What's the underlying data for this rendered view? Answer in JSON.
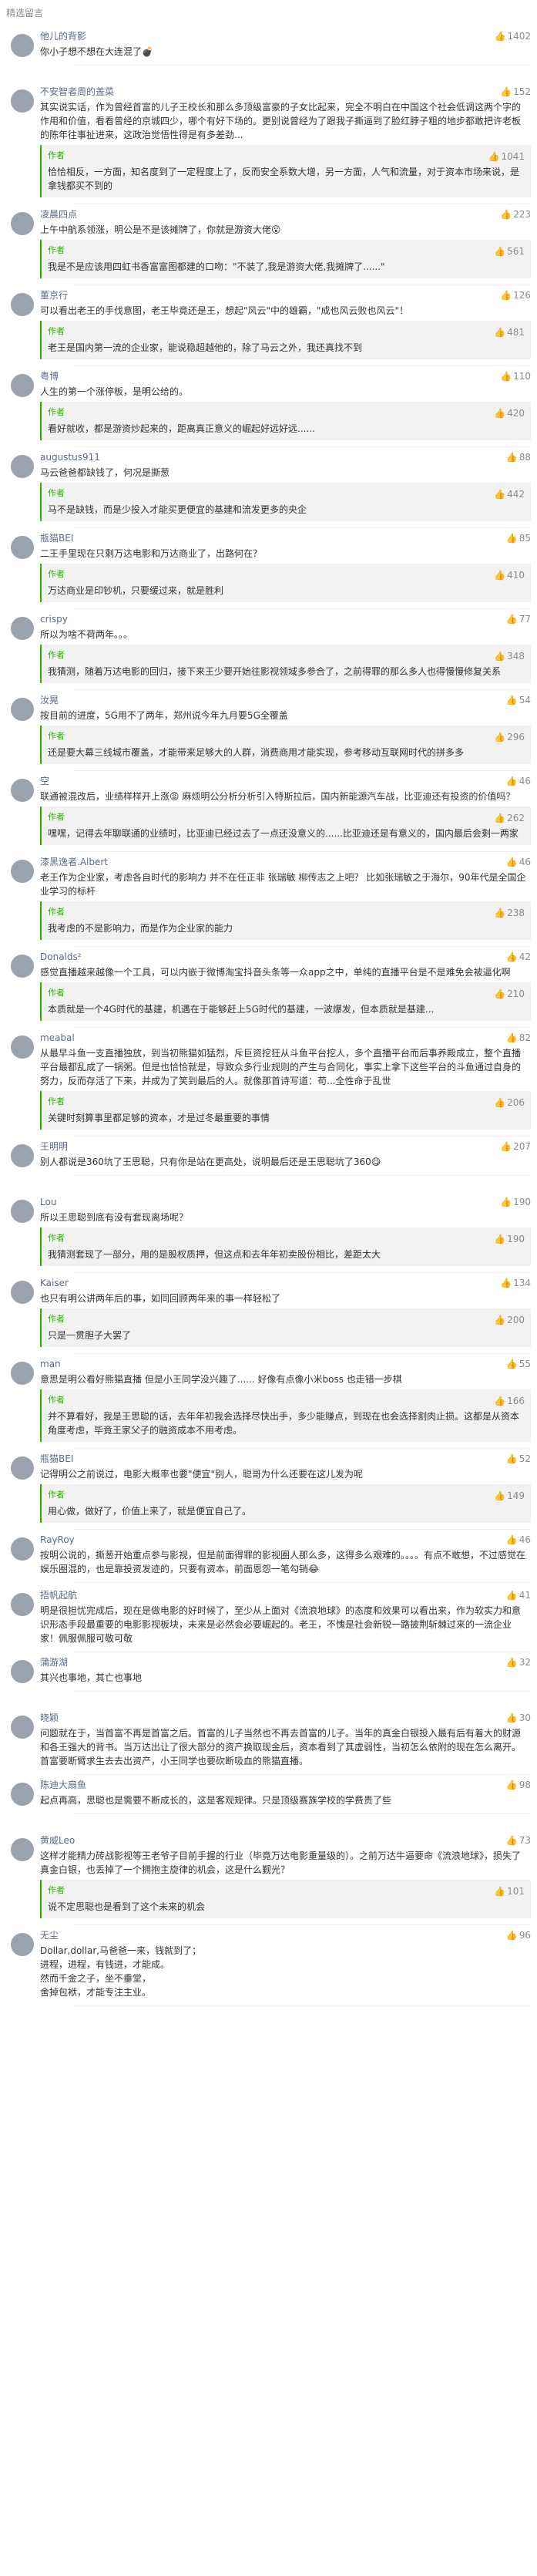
{
  "header": {
    "title": "精选留言"
  },
  "comments": [
    {
      "user": "他儿的背影",
      "likes": "1402",
      "text": "你小子想不想在大连混了💣",
      "reply": null
    },
    {
      "user": "不安智者周的盖菜",
      "likes": "152",
      "text": "其实说实话，作为曾经首富的儿子王校长和那么多顶级富豪的子女比起来，完全不明白在中国这个社会低调这两个字的作用和价值，看看曾经的京城四少，哪个有好下场的。更别说曾经为了跟我子撕逼到了脸红脖子粗的地步都敢把许老板的陈年往事扯进来，这政治觉悟性得是有多差劲...",
      "reply": {
        "tag": "作者",
        "likes": "1041",
        "text": "恰恰相反，一方面，知名度到了一定程度上了，反而安全系数大增，另一方面，人气和流量，对于资本市场来说，是拿钱都买不到的"
      }
    },
    {
      "user": "凌晨四点",
      "likes": "223",
      "text": "上午中航系领涨，明公是不是该摊牌了，你就是游资大佬😮",
      "reply": {
        "tag": "作者",
        "likes": "561",
        "text": "我是不是应该用四虹书香富富图都建的口吻：\"不装了,我是游资大佬,我摊牌了......\""
      }
    },
    {
      "user": "董京行",
      "likes": "126",
      "text": "可以看出老王的手伐意图，老王毕竟还是王，想起\"风云\"中的雄霸，\"成也风云败也风云\"！",
      "reply": {
        "tag": "作者",
        "likes": "481",
        "text": "老王是国内第一流的企业家，能说稳超越他的，除了马云之外，我还真找不到"
      }
    },
    {
      "user": "粤博",
      "likes": "110",
      "text": "人生的第一个涨停板，是明公给的。",
      "reply": {
        "tag": "作者",
        "likes": "420",
        "text": "看好就收，都是游资炒起来的，距离真正意义的崛起好远好远......"
      }
    },
    {
      "user": "augustus911",
      "likes": "88",
      "text": "马云爸爸都缺钱了，何况是撕葱",
      "reply": {
        "tag": "作者",
        "likes": "442",
        "text": "马不是缺钱，而是少投入才能买更便宜的基建和流发更多的央企"
      }
    },
    {
      "user": "瓶猫BEI",
      "likes": "85",
      "text": "二王手里现在只剩万达电影和万达商业了，出路何在？",
      "reply": {
        "tag": "作者",
        "likes": "410",
        "text": "万达商业是印钞机，只要缓过来，就是胜利"
      }
    },
    {
      "user": "crispy",
      "likes": "77",
      "text": "所以为啥不荷两年。。。",
      "reply": {
        "tag": "作者",
        "likes": "348",
        "text": "我猜测，随着万达电影的回归，接下来王少要开始往影视领域多参合了，之前得罪的那么多人也得慢慢修复关系"
      }
    },
    {
      "user": "汝晃",
      "likes": "54",
      "text": "按目前的进度，5G用不了两年，郑州说今年九月要5G全覆盖",
      "reply": {
        "tag": "作者",
        "likes": "296",
        "text": "还是要大幕三线城市覆盖，才能带来足够大的人群，消费商用才能实现，参考移动互联网时代的拼多多"
      }
    },
    {
      "user": "空",
      "likes": "46",
      "text": "联通被混改后，业绩样样开上涨😡 麻烦明公分析分析引入特斯拉后，国内新能源汽车战，比亚迪还有投资的价值吗？",
      "reply": {
        "tag": "作者",
        "likes": "262",
        "text": "嘿嘿，记得去年聊联通的业绩时，比亚迪已经过去了一点还没意义的......比亚迪还是有意义的，国内最后会剩一两家"
      }
    },
    {
      "user": "漆黑逸者.Albert",
      "likes": "46",
      "text": "老王作为企业家，考虑各自时代的影响力 并不在任正非 张瑞敏 柳传志之上吧？ 比如张瑞敏之于海尔，90年代是全国企业学习的标杆",
      "reply": {
        "tag": "作者",
        "likes": "238",
        "text": "我考虑的不是影响力，而是作为企业家的能力"
      }
    },
    {
      "user": "Donalds²",
      "likes": "42",
      "text": "感觉直播越来越像一个工具，可以内嵌于微博淘宝抖音头条等一众app之中，单纯的直播平台是不是难免会被逼化啊",
      "reply": {
        "tag": "作者",
        "likes": "210",
        "text": "本质就是一个4G时代的基建，机遇在于能够赶上5G时代的基建，一波爆发，但本质就是基建..."
      }
    },
    {
      "user": "meabal",
      "likes": "82",
      "text": "从最早斗鱼一支直播独放，到当初熊猫如猛烈，斥巨资挖狂从斗鱼平台挖人，多个直播平台而后事养殿成立，整个直播平台最都乱成了一锅粥。但是也恰恰就是，导致众多行业规则的产生与合同化，事实上拿下这些平台的斗鱼通过自身的努力，反而存活了下来，并成为了笑到最后的人。就像那首诗写道：苟...全性命于乱世",
      "reply": {
        "tag": "作者",
        "likes": "206",
        "text": "关键时刻算事里都足够的资本，才是过冬最重要的事情"
      }
    },
    {
      "user": "王明明",
      "likes": "207",
      "text": "别人都说是360坑了王思聪，只有你是站在更高处，说明最后还是王思聪坑了360😋",
      "reply": null
    },
    {
      "user": "Lou",
      "likes": "190",
      "text": "所以王思聪到底有没有套现离场呢？",
      "reply": {
        "tag": "作者",
        "likes": "190",
        "text": "我猜测套现了一部分，用的是股权质押，但这点和去年年初卖股份相比，差距太大"
      }
    },
    {
      "user": "Kaiser",
      "likes": "134",
      "text": "也只有明公讲两年后的事，如同回顾两年来的事一样轻松了",
      "reply": {
        "tag": "作者",
        "likes": "200",
        "text": "只是一贯胆子大罢了"
      }
    },
    {
      "user": "man",
      "likes": "55",
      "text": "意思是明公看好熊猫直播 但是小王同学没兴趣了...... 好像有点像小米boss 也走错一步棋",
      "reply": {
        "tag": "作者",
        "likes": "166",
        "text": "并不算看好，我是王思聪的话，去年年初我会选择尽快出手，多少能赚点，到现在也会选择割肉止损。这都是从资本角度考虑，毕竟王家父子的融资成本不用考虑。"
      }
    },
    {
      "user": "瓶猫BEI",
      "likes": "52",
      "text": "记得明公之前说过，电影大概率也要\"便宜\"别人，聪哥为什么还要在这儿发为呢",
      "reply": {
        "tag": "作者",
        "likes": "149",
        "text": "用心做，做好了，价值上来了，就是便宜自己了。"
      }
    },
    {
      "user": "RayRoy",
      "likes": "46",
      "text": "按明公说的，撕葱开始重点参与影视，但是前面得罪的影视圈人那么多，这得多么艰难的。。。。有点不敢想，不过感觉在娱乐圈混的，也是靠投资发迹的，只要有资本，前面恩怨一笔勾销😂",
      "reply": null
    },
    {
      "user": "捂帆起航",
      "likes": "41",
      "text": "明是很担忧完成后，现在是做电影的好时候了，至少从上面对《流浪地球》的态度和效果可以看出来，作为软实力和意识形态手段最重要的电影影视板块，未来是必然会必要崛起的。老王，不愧是社会新锐一路披荆斩棘过来的一流企业家！佩服佩服可敬可敬",
      "reply": null
    },
    {
      "user": "蒲游湖",
      "likes": "32",
      "text": "其兴也事地，其亡也事地",
      "reply": null
    },
    {
      "user": "晓颖",
      "likes": "30",
      "text": "问题就在于，当首富不再是首富之后。首富的儿子当然也不再去首富的儿子。当年的真金白银投入最有后有着大的财源和各王强大的背书。当万达出让了很大部分的资产换取现金后，资本看到了其虚弱性，当初怎么依附的现在怎么离开。首富要断臂求生去去出资产，小王同学也要砍断吸血的熊猫直播。",
      "reply": null
    },
    {
      "user": "陈迪大扇鱼",
      "likes": "98",
      "text": "起点再高，思聪也是需要不断成长的，这是客观规律。只是顶级赛族学校的学费贵了些",
      "reply": null
    },
    {
      "user": "黄威Leo",
      "likes": "73",
      "text": "这样才能精力砖战影视等王老爷子目前手握的行业（毕竟万达电影重量级的）。之前万达牛逼要命《流浪地球》，损失了真金白银，也丢掉了一个拥抱主旋律的机会，这是什么觐光？",
      "reply": {
        "tag": "作者",
        "likes": "101",
        "text": "说不定思聪也是看到了这个未来的机会"
      }
    },
    {
      "user": "无尘",
      "likes": "96",
      "text": "Dollar,dollar,马爸爸一来，钱就到了；\n进程，进程，有钱进，才能成。\n然而千金之子，坐不垂堂，\n舍掉包袱，才能专注主业。",
      "reply": null
    }
  ]
}
